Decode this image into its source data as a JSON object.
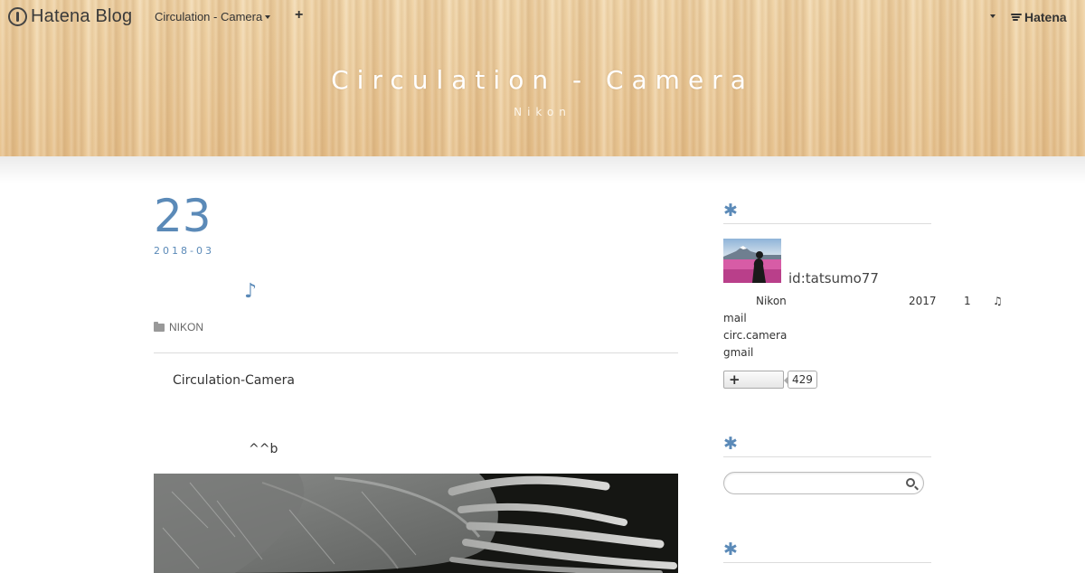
{
  "topbar": {
    "logo_text": "Hatena Blog",
    "blog_menu_label": "Circulation - Camera",
    "add_label": "+",
    "hatena_label": "Hatena"
  },
  "header": {
    "title": "Circulation - Camera",
    "subtitle": "Nikon"
  },
  "entry": {
    "day": "23",
    "year_month": "2018-03",
    "title": "♪",
    "category": "NIKON",
    "paragraph1": "Circulation-Camera",
    "paragraph2": "^^b"
  },
  "sidebar": {
    "profile_heading_icon": "asterisk-icon",
    "profile": {
      "id": "id:tatsumo77",
      "row": [
        "Nikon",
        "2017",
        "1",
        "♫"
      ],
      "lines": [
        "mail",
        "circ.camera",
        "gmail"
      ],
      "follow_label": "+",
      "follow_count": "429"
    },
    "search": {
      "placeholder": ""
    }
  },
  "colors": {
    "accent": "#5b8ab8",
    "header_wood": "#e8c898"
  }
}
